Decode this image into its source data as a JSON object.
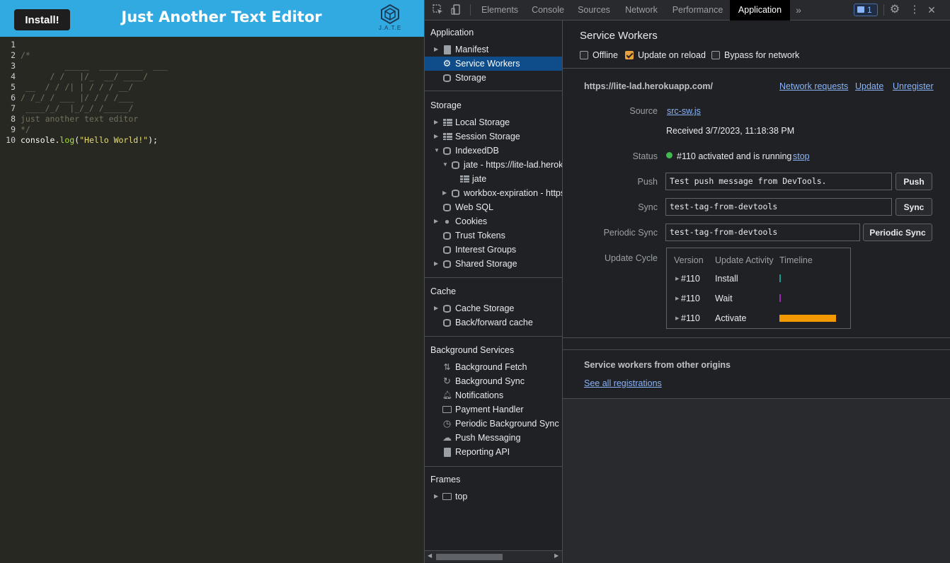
{
  "app": {
    "install_label": "Install!",
    "title": "Just Another Text Editor",
    "logo_text": "J.A.T.E",
    "editor_lines": [
      {
        "num": "1",
        "text": "",
        "kind": "plain"
      },
      {
        "num": "2",
        "text": "/*",
        "kind": "comment"
      },
      {
        "num": "3",
        "text": "         _____  _________  ___",
        "kind": "comment"
      },
      {
        "num": "4",
        "text": "      / /   |/_  __/ ____/",
        "kind": "comment"
      },
      {
        "num": "5",
        "text": " __  / / /| | / / / __/",
        "kind": "comment"
      },
      {
        "num": "6",
        "text": "/ /_/ / ___ |/ / / /___",
        "kind": "comment"
      },
      {
        "num": "7",
        "text": " ____/_/  |_/_/ /_____/",
        "kind": "comment"
      },
      {
        "num": "8",
        "text": "just another text editor",
        "kind": "comment"
      },
      {
        "num": "9",
        "text": "*/",
        "kind": "comment"
      },
      {
        "num": "10",
        "text": "",
        "kind": "code"
      }
    ],
    "code_line": {
      "obj": "console",
      "dot": ".",
      "method": "log",
      "open": "(",
      "str": "\"Hello World!\"",
      "close": ");"
    }
  },
  "devtools": {
    "tabs": [
      "Elements",
      "Console",
      "Sources",
      "Network",
      "Performance",
      "Application"
    ],
    "active_tab": "Application",
    "more_tabs": "»",
    "issues_count": "1",
    "sidebar": {
      "application_head": "Application",
      "application_items": [
        "Manifest",
        "Service Workers",
        "Storage"
      ],
      "storage_head": "Storage",
      "storage_items": [
        "Local Storage",
        "Session Storage",
        "IndexedDB",
        "jate - https://lite-lad.herok",
        "jate",
        "workbox-expiration - https",
        "Web SQL",
        "Cookies",
        "Trust Tokens",
        "Interest Groups",
        "Shared Storage"
      ],
      "cache_head": "Cache",
      "cache_items": [
        "Cache Storage",
        "Back/forward cache"
      ],
      "bg_head": "Background Services",
      "bg_items": [
        "Background Fetch",
        "Background Sync",
        "Notifications",
        "Payment Handler",
        "Periodic Background Sync",
        "Push Messaging",
        "Reporting API"
      ],
      "frames_head": "Frames",
      "frames_items": [
        "top"
      ]
    },
    "main": {
      "title": "Service Workers",
      "checkboxes": [
        {
          "label": "Offline",
          "checked": false
        },
        {
          "label": "Update on reload",
          "checked": true
        },
        {
          "label": "Bypass for network",
          "checked": false
        }
      ],
      "origin": "https://lite-lad.herokuapp.com/",
      "links": {
        "network_requests": "Network requests",
        "update": "Update",
        "unregister": "Unregister"
      },
      "source_label": "Source",
      "source_file": "src-sw.js",
      "received": "Received 3/7/2023, 11:18:38 PM",
      "status_label": "Status",
      "status_text": "#110 activated and is running",
      "stop_link": "stop",
      "push_label": "Push",
      "push_value": "Test push message from DevTools.",
      "push_button": "Push",
      "sync_label": "Sync",
      "sync_value": "test-tag-from-devtools",
      "sync_button": "Sync",
      "periodic_label": "Periodic Sync",
      "periodic_value": "test-tag-from-devtools",
      "periodic_button": "Periodic Sync",
      "update_cycle_label": "Update Cycle",
      "update_cycle": {
        "headers": [
          "Version",
          "Update Activity",
          "Timeline"
        ],
        "rows": [
          {
            "version": "#110",
            "activity": "Install",
            "color": "#1a9a8a"
          },
          {
            "version": "#110",
            "activity": "Wait",
            "color": "#9c27b0"
          },
          {
            "version": "#110",
            "activity": "Activate",
            "color": "#f29900"
          }
        ]
      },
      "other_origins_title": "Service workers from other origins",
      "see_all": "See all registrations"
    }
  }
}
